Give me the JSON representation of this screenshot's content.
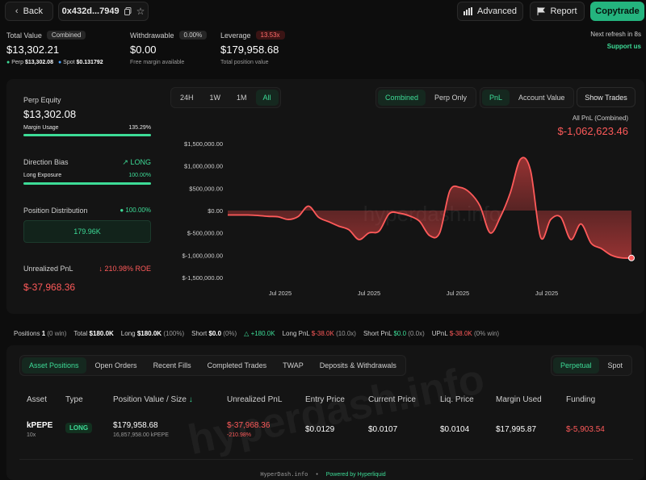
{
  "header": {
    "back_label": "Back",
    "address": "0x432d...7949",
    "advanced_label": "Advanced",
    "report_label": "Report",
    "copytrade_label": "Copytrade"
  },
  "summary": {
    "total_value_label": "Total Value",
    "total_value_badge": "Combined",
    "total_value": "$13,302.21",
    "perp_label": "Perp",
    "perp_value": "$13,302.08",
    "spot_label": "Spot",
    "spot_value": "$0.131792",
    "withdrawable_label": "Withdrawable",
    "withdrawable_badge": "0.00%",
    "withdrawable_value": "$0.00",
    "withdrawable_sub": "Free margin available",
    "leverage_label": "Leverage",
    "leverage_badge": "13.53x",
    "leverage_value": "$179,958.68",
    "leverage_sub": "Total position value",
    "refresh_text": "Next refresh in 8s",
    "support_text": "Support us"
  },
  "left_panel": {
    "perp_equity_label": "Perp Equity",
    "perp_equity_value": "$13,302.08",
    "margin_usage_label": "Margin Usage",
    "margin_usage_value": "135.29%",
    "margin_usage_fill": 1.0,
    "direction_bias_label": "Direction Bias",
    "direction_bias_value": "LONG",
    "long_exposure_label": "Long Exposure",
    "long_exposure_value": "100.00%",
    "long_exposure_fill": 1.0,
    "position_distribution_label": "Position Distribution",
    "position_distribution_value": "100.00%",
    "distribution_box_value": "179.96K",
    "unrealized_pnl_label": "Unrealized PnL",
    "roe_value": "210.98% ROE",
    "unrealized_pnl_value": "$-37,968.36"
  },
  "chart_controls": {
    "ranges": [
      "24H",
      "1W",
      "1M",
      "All"
    ],
    "active_range": "All",
    "views": [
      "Combined",
      "Perp Only"
    ],
    "active_view": "Combined",
    "metrics": [
      "PnL",
      "Account Value"
    ],
    "active_metric": "PnL",
    "show_trades_label": "Show Trades",
    "all_pnl_label": "All PnL (Combined)",
    "all_pnl_value": "$-1,062,623.46",
    "watermark": "hyperdash.info"
  },
  "chart_data": {
    "type": "area",
    "title": "All PnL (Combined)",
    "xlabel": "",
    "ylabel": "",
    "ylim": [
      -1500000,
      1500000
    ],
    "yticks": [
      "$1,500,000.00",
      "$1,000,000.00",
      "$500,000.00",
      "$0.00",
      "$-500,000.00",
      "$-1,000,000.00",
      "$-1,500,000.00"
    ],
    "ytick_values": [
      1500000,
      1000000,
      500000,
      0,
      -500000,
      -1000000,
      -1500000
    ],
    "xtick_labels": [
      "Jul 2025",
      "Jul 2025",
      "Jul 2025",
      "Jul 2025"
    ],
    "grid": false,
    "series": [
      {
        "values": [
          -100000,
          -100000,
          -100000,
          -110000,
          -130000,
          -140000,
          -200000,
          -130000,
          100000,
          -150000,
          -250000,
          -350000,
          -430000,
          -650000,
          -500000,
          -460000,
          -70000,
          -60000,
          -120000,
          -240000,
          -560000,
          -500000,
          440000,
          520000,
          400000,
          100000,
          -500000,
          -150000,
          400000,
          1150000,
          900000,
          -600000,
          -200000,
          -150000,
          -650000,
          -300000,
          -730000,
          -850000,
          -1000000,
          -1060000,
          -1062623
        ]
      }
    ]
  },
  "stats_bar": {
    "positions_label": "Positions",
    "positions_value": "1",
    "positions_win": "(0 win)",
    "total_label": "Total",
    "total_value": "$180.0K",
    "long_label": "Long",
    "long_value": "$180.0K",
    "long_pct": "(100%)",
    "short_label": "Short",
    "short_value": "$0.0",
    "short_pct": "(0%)",
    "delta_value": "+180.0K",
    "long_pnl_label": "Long PnL",
    "long_pnl_value": "$-38.0K",
    "long_pnl_x": "(10.0x)",
    "short_pnl_label": "Short PnL",
    "short_pnl_value": "$0.0",
    "short_pnl_x": "(0.0x)",
    "upnl_label": "UPnL",
    "upnl_value": "$-38.0K",
    "upnl_win": "(0% win)"
  },
  "tabs": {
    "items": [
      "Asset Positions",
      "Open Orders",
      "Recent Fills",
      "Completed Trades",
      "TWAP",
      "Deposits & Withdrawals"
    ],
    "active": "Asset Positions",
    "market_items": [
      "Perpetual",
      "Spot"
    ],
    "active_market": "Perpetual"
  },
  "table": {
    "headers": [
      "Asset",
      "Type",
      "Position Value / Size",
      "Unrealized PnL",
      "Entry Price",
      "Current Price",
      "Liq. Price",
      "Margin Used",
      "Funding"
    ],
    "rows": [
      {
        "asset": "kPEPE",
        "leverage": "10x",
        "type": "LONG",
        "position_value": "$179,958.68",
        "size": "16,857,958.00 kPEPE",
        "unrealized_pnl": "$-37,968.36",
        "pnl_pct": "-210.98%",
        "entry_price": "$0.0129",
        "current_price": "$0.0107",
        "liq_price": "$0.0104",
        "margin_used": "$17,995.87",
        "funding": "$-5,903.54"
      }
    ]
  },
  "footer": {
    "site": "HyperDash.info",
    "separator": "•",
    "powered_by": "Powered by Hyperliquid"
  },
  "colors": {
    "accent_green": "#3ddc97",
    "negative_red": "#ff5a5a",
    "background": "#0d0d0d"
  }
}
